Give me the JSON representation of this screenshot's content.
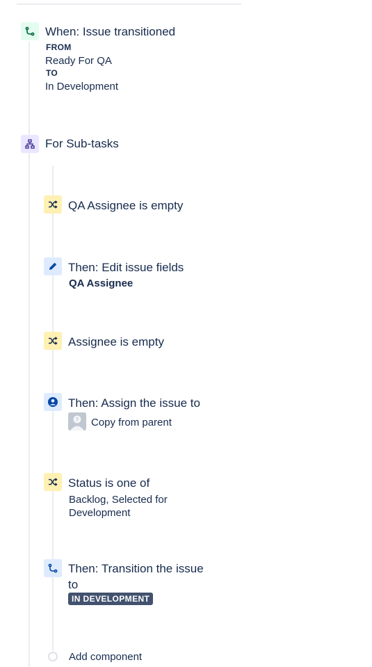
{
  "trigger": {
    "title": "When: Issue transitioned",
    "from_label": "FROM",
    "from_value": "Ready For QA",
    "to_label": "TO",
    "to_value": "In Development",
    "icon": "transition-icon"
  },
  "branch": {
    "title": "For Sub-tasks",
    "icon": "hierarchy-icon"
  },
  "components": [
    {
      "type": "condition",
      "title": "QA Assignee is empty",
      "icon": "shuffle-icon"
    },
    {
      "type": "action",
      "title": "Then: Edit issue fields",
      "detail": "QA Assignee",
      "icon": "pencil-icon"
    },
    {
      "type": "condition",
      "title": "Assignee is empty",
      "icon": "shuffle-icon"
    },
    {
      "type": "action",
      "title": "Then: Assign the issue to",
      "detail": "Copy from parent",
      "icon": "user-circle-icon"
    },
    {
      "type": "condition",
      "title": "Status is one of",
      "detail_line1": "Backlog, Selected for",
      "detail_line2": "Development",
      "icon": "shuffle-icon"
    },
    {
      "type": "action",
      "title_line1": "Then: Transition the issue",
      "title_line2": "to",
      "lozenge": "IN DEVELOPMENT",
      "icon": "transition-icon"
    }
  ],
  "add_component": {
    "label": "Add component"
  },
  "colors": {
    "text": "#172B4D",
    "trigger_icon_bg": "#E3FCEF",
    "branch_icon_bg": "#EAE6FF",
    "condition_icon_bg": "#FFF0B3",
    "action_icon_bg": "#DEEBFF",
    "lozenge_bg": "#42526E"
  }
}
